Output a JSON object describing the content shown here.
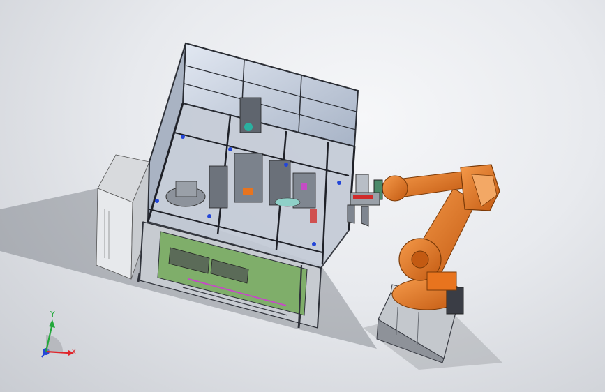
{
  "viewport": {
    "background_top": "#f6f7f9",
    "background_bottom": "#c9ccd2"
  },
  "triad": {
    "x_label": "X",
    "y_label": "Y",
    "x_color": "#e0262c",
    "y_color": "#22a83a",
    "z_color": "#2346d8"
  },
  "colors": {
    "robot_orange": "#e8741e",
    "robot_dark": "#a94a0e",
    "frame_dark": "#3a3d45",
    "glass": "#b9c4d6",
    "panel_green": "#7fae6a",
    "cabinet_white": "#e7e9ec",
    "base_grey": "#bfc3c8"
  }
}
